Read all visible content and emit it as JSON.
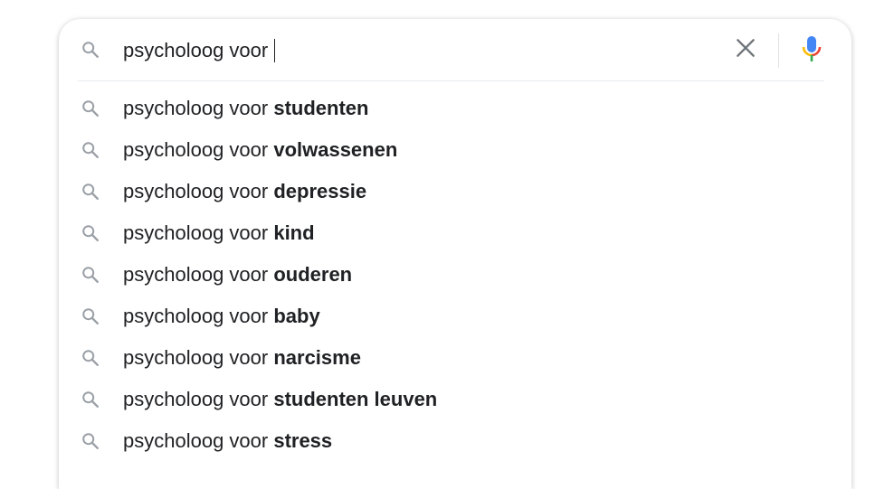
{
  "search": {
    "query": "psycholoog voor ",
    "icon": "search-icon",
    "clear_icon": "close-icon",
    "voice_icon": "microphone-icon"
  },
  "colors": {
    "text": "#202124",
    "icon_gray": "#9aa0a6",
    "clear_gray": "#70757a",
    "mic_blue": "#4285f4",
    "mic_red": "#ea4335",
    "mic_yellow": "#fbbc04",
    "mic_green": "#34a853"
  },
  "suggestions": [
    {
      "prefix": "psycholoog voor ",
      "completion": "studenten"
    },
    {
      "prefix": "psycholoog voor ",
      "completion": "volwassenen"
    },
    {
      "prefix": "psycholoog voor ",
      "completion": "depressie"
    },
    {
      "prefix": "psycholoog voor ",
      "completion": "kind"
    },
    {
      "prefix": "psycholoog voor ",
      "completion": "ouderen"
    },
    {
      "prefix": "psycholoog voor ",
      "completion": "baby"
    },
    {
      "prefix": "psycholoog voor ",
      "completion": "narcisme"
    },
    {
      "prefix": "psycholoog voor ",
      "completion": "studenten leuven"
    },
    {
      "prefix": "psycholoog voor ",
      "completion": "stress"
    }
  ]
}
